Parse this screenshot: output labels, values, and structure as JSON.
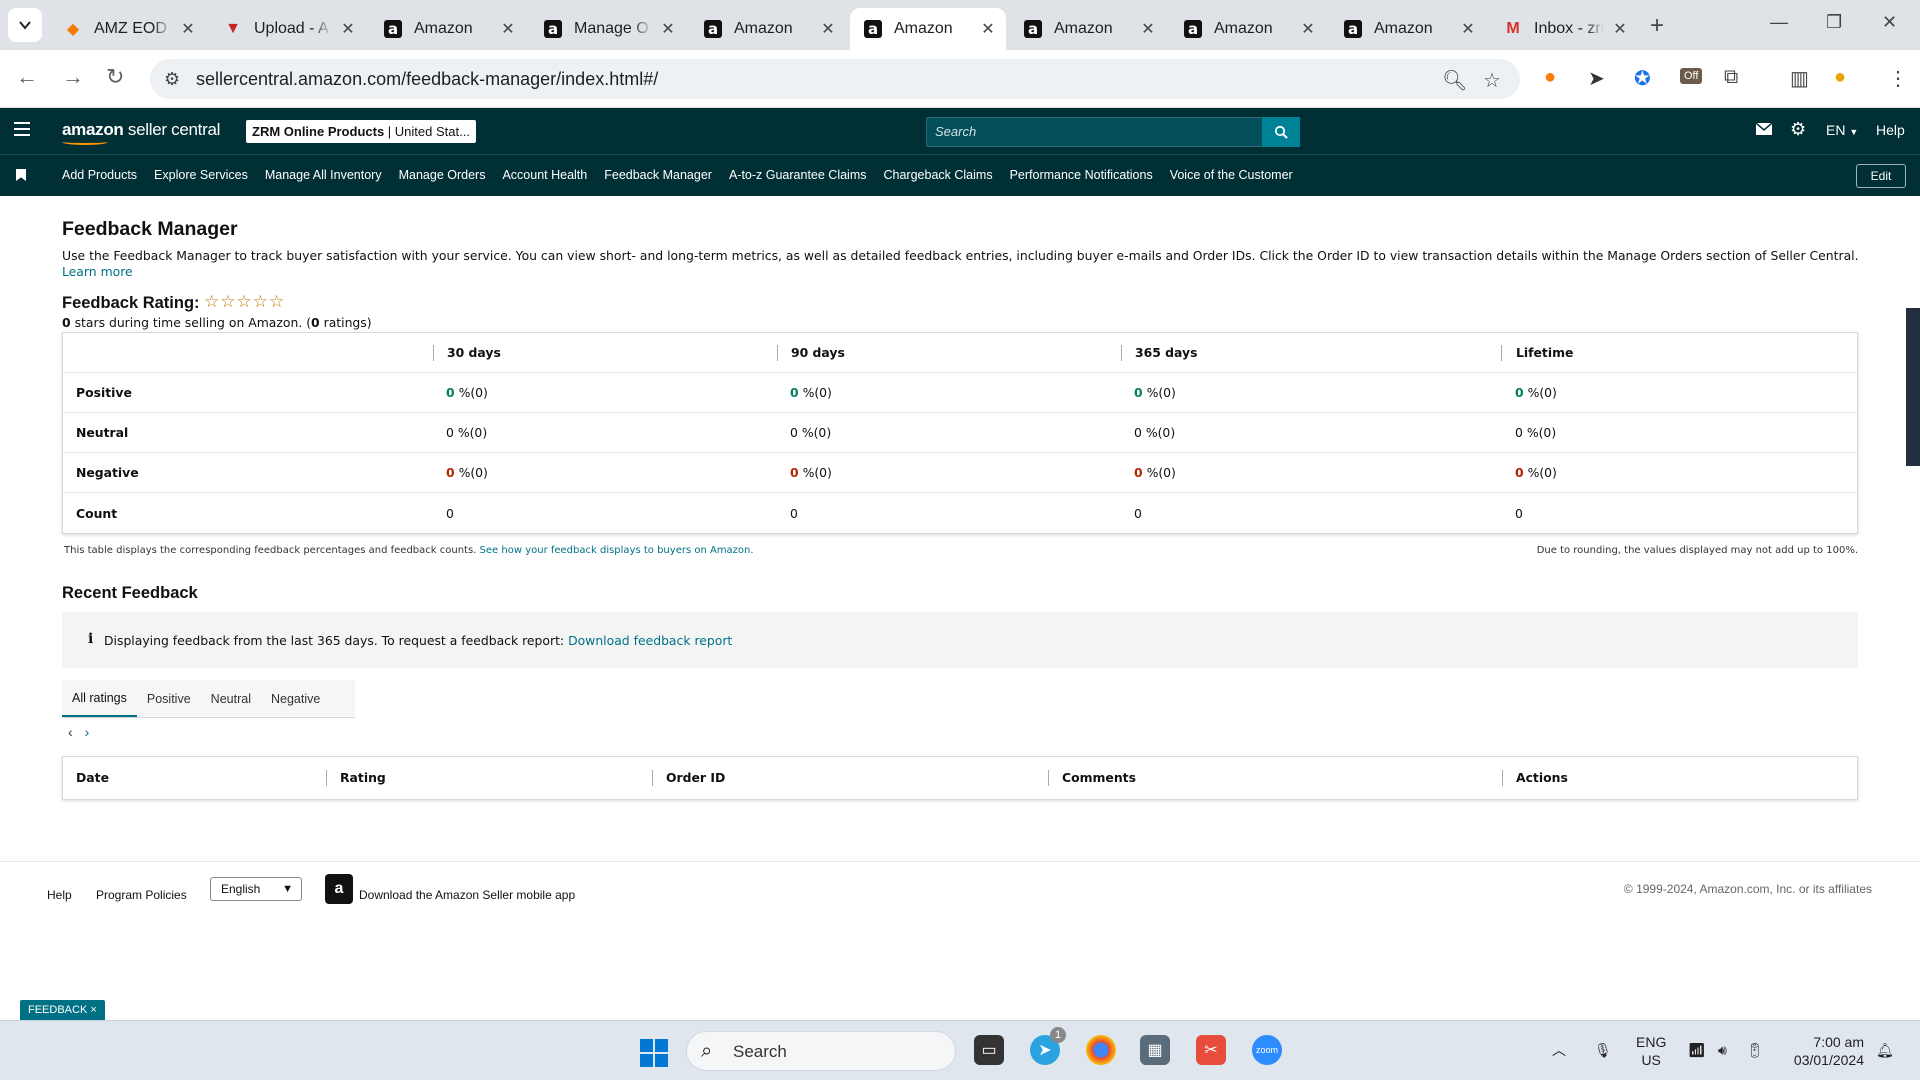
{
  "browser": {
    "tabs": [
      {
        "title": "AMZ EOD",
        "icon": "ql-icon",
        "active": false
      },
      {
        "title": "Upload - A",
        "icon": "upload-favicon",
        "active": false
      },
      {
        "title": "Amazon",
        "icon": "amazon-favicon",
        "active": false
      },
      {
        "title": "Manage O",
        "icon": "amazon-favicon",
        "active": false
      },
      {
        "title": "Amazon",
        "icon": "amazon-favicon",
        "active": false
      },
      {
        "title": "Amazon",
        "icon": "amazon-favicon",
        "active": true
      },
      {
        "title": "Amazon",
        "icon": "amazon-favicon",
        "active": false
      },
      {
        "title": "Amazon",
        "icon": "amazon-favicon",
        "active": false
      },
      {
        "title": "Amazon",
        "icon": "amazon-favicon",
        "active": false
      },
      {
        "title": "Inbox - zrr",
        "icon": "gmail-favicon",
        "active": false
      }
    ],
    "url": "sellercentral.amazon.com/feedback-manager/index.html#/",
    "ext_badge": "Off"
  },
  "header": {
    "logo_bold": "amazon",
    "logo_light": " seller central",
    "store_name": "ZRM Online Products",
    "store_region": " | United Stat...",
    "search_placeholder": "Search",
    "language": "EN",
    "help": "Help"
  },
  "nav": {
    "links": [
      "Add Products",
      "Explore Services",
      "Manage All Inventory",
      "Manage Orders",
      "Account Health",
      "Feedback Manager",
      "A-to-z Guarantee Claims",
      "Chargeback Claims",
      "Performance Notifications",
      "Voice of the Customer"
    ],
    "edit": "Edit"
  },
  "page": {
    "title": "Feedback Manager",
    "intro": "Use the Feedback Manager to track buyer satisfaction with your service. You can view short- and long-term metrics, as well as detailed feedback entries, including buyer e-mails and Order IDs. Click the Order ID to view transaction details within the Manage Orders section of Seller Central.",
    "learn_more": "Learn more",
    "rating_label": "Feedback Rating:",
    "star_count": 5,
    "stars_filled": 0,
    "rating_value": "0",
    "rating_text": " stars during time selling on Amazon. (",
    "rating_count": "0",
    "rating_suffix": " ratings)"
  },
  "feedback_table": {
    "columns": [
      "30 days",
      "90 days",
      "365 days",
      "Lifetime"
    ],
    "rows": [
      {
        "label": "Positive",
        "kind": "pos",
        "cells": [
          {
            "n": "0",
            "s": " %(0)"
          },
          {
            "n": "0",
            "s": " %(0)"
          },
          {
            "n": "0",
            "s": " %(0)"
          },
          {
            "n": "0",
            "s": " %(0)"
          }
        ]
      },
      {
        "label": "Neutral",
        "kind": "neu",
        "cells": [
          {
            "n": "0",
            "s": " %(0)"
          },
          {
            "n": "0",
            "s": " %(0)"
          },
          {
            "n": "0",
            "s": " %(0)"
          },
          {
            "n": "0",
            "s": " %(0)"
          }
        ]
      },
      {
        "label": "Negative",
        "kind": "neg",
        "cells": [
          {
            "n": "0",
            "s": " %(0)"
          },
          {
            "n": "0",
            "s": " %(0)"
          },
          {
            "n": "0",
            "s": " %(0)"
          },
          {
            "n": "0",
            "s": " %(0)"
          }
        ]
      },
      {
        "label": "Count",
        "kind": "plain",
        "cells": [
          {
            "n": "0",
            "s": ""
          },
          {
            "n": "0",
            "s": ""
          },
          {
            "n": "0",
            "s": ""
          },
          {
            "n": "0",
            "s": ""
          }
        ]
      }
    ],
    "note": "This table displays the corresponding feedback percentages and feedback counts.",
    "note_link": "See how your feedback displays to buyers on Amazon.",
    "rounding_note": "Due to rounding, the values displayed may not add up to 100%."
  },
  "recent": {
    "title": "Recent Feedback",
    "info_text": "Displaying feedback from the last 365 days. To request a feedback report:",
    "info_link": "Download feedback report",
    "tabs": [
      "All ratings",
      "Positive",
      "Neutral",
      "Negative"
    ],
    "active_tab": "All ratings",
    "columns": [
      "Date",
      "Rating",
      "Order ID",
      "Comments",
      "Actions"
    ]
  },
  "footer": {
    "help": "Help",
    "policies": "Program Policies",
    "language": "English",
    "app_text": "Download the Amazon Seller mobile app",
    "copyright": "© 1999-2024, Amazon.com, Inc. or its affiliates",
    "feedback_pill": "FEEDBACK ×"
  },
  "taskbar": {
    "search": "Search",
    "telegram_badge": "1",
    "lang_top": "ENG",
    "lang_bottom": "US",
    "time": "7:00 am",
    "date": "03/01/2024"
  }
}
